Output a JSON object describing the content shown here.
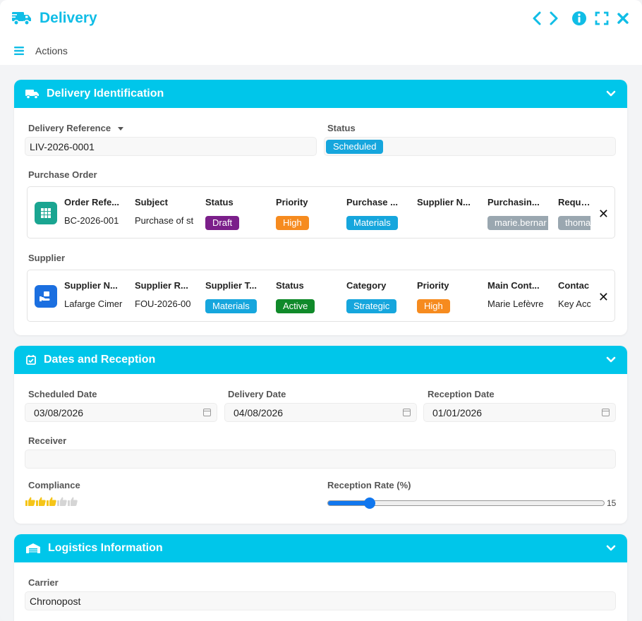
{
  "app": {
    "title": "Delivery",
    "actions_label": "Actions"
  },
  "colors": {
    "accent": "#00c6ea",
    "draft": "#7b1f8a",
    "high": "#f68b1f",
    "info": "#16a6dd",
    "active": "#108a2a",
    "tag_gray": "#9aa7b0"
  },
  "sections": {
    "identification": {
      "title": "Delivery Identification",
      "delivery_reference_label": "Delivery Reference",
      "delivery_reference_value": "LIV-2026-0001",
      "status_label": "Status",
      "status_value": "Scheduled",
      "purchase_order_label": "Purchase Order",
      "purchase_order": {
        "columns": [
          {
            "header": "Order Refe...",
            "value": "BC-2026-001"
          },
          {
            "header": "Subject",
            "value": "Purchase of st"
          },
          {
            "header": "Status",
            "badge": "Draft"
          },
          {
            "header": "Priority",
            "badge": "High"
          },
          {
            "header": "Purchase ...",
            "badge": "Materials"
          },
          {
            "header": "Supplier N...",
            "value": ""
          },
          {
            "header": "Purchasin...",
            "tag": "marie.bernar"
          },
          {
            "header": "Reques",
            "tag": "thoma"
          }
        ]
      },
      "supplier_label": "Supplier",
      "supplier": {
        "columns": [
          {
            "header": "Supplier N...",
            "value": "Lafarge Cimer"
          },
          {
            "header": "Supplier R...",
            "value": "FOU-2026-00"
          },
          {
            "header": "Supplier T...",
            "badge": "Materials"
          },
          {
            "header": "Status",
            "badge": "Active"
          },
          {
            "header": "Category",
            "badge": "Strategic"
          },
          {
            "header": "Priority",
            "badge": "High"
          },
          {
            "header": "Main Cont...",
            "value": "Marie Lefèvre"
          },
          {
            "header": "Contac",
            "value": "Key Acc"
          }
        ]
      }
    },
    "dates": {
      "title": "Dates and Reception",
      "scheduled_label": "Scheduled Date",
      "scheduled_value": "03/08/2026",
      "delivery_label": "Delivery Date",
      "delivery_value": "04/08/2026",
      "reception_label": "Reception Date",
      "reception_value": "01/01/2026",
      "receiver_label": "Receiver",
      "receiver_value": "",
      "compliance_label": "Compliance",
      "compliance_rating": 3,
      "compliance_max": 5,
      "rate_label": "Reception Rate (%)",
      "rate_value": "15"
    },
    "logistics": {
      "title": "Logistics Information",
      "carrier_label": "Carrier",
      "carrier_value": "Chronopost"
    }
  }
}
